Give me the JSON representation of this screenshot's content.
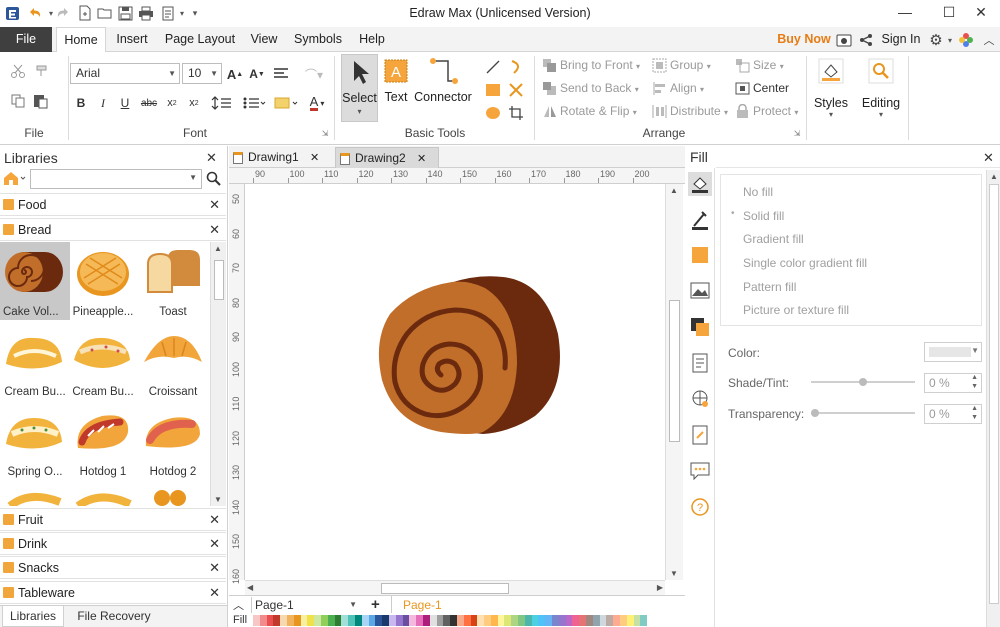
{
  "app": {
    "title": "Edraw Max (Unlicensed Version)"
  },
  "menu": {
    "file": "File",
    "tabs": [
      "Home",
      "Insert",
      "Page Layout",
      "View",
      "Symbols",
      "Help"
    ],
    "buy_now": "Buy Now",
    "sign_in": "Sign In"
  },
  "ribbon": {
    "font_name": "Arial",
    "font_size": "10",
    "groups": {
      "file": "File",
      "font": "Font",
      "basic_tools": "Basic Tools",
      "arrange": "Arrange"
    },
    "select": "Select",
    "text": "Text",
    "connector": "Connector",
    "arrange": {
      "bring_to_front": "Bring to Front",
      "send_to_back": "Send to Back",
      "rotate_flip": "Rotate & Flip",
      "group": "Group",
      "align": "Align",
      "distribute": "Distribute",
      "size": "Size",
      "center": "Center",
      "protect": "Protect"
    },
    "styles": "Styles",
    "editing": "Editing"
  },
  "libraries": {
    "title": "Libraries",
    "search_value": "",
    "categories_top": [
      "Food",
      "Bread"
    ],
    "bread_items": [
      "Cake Vol...",
      "Pineapple...",
      "Toast",
      "Cream Bu...",
      "Cream Bu...",
      "Croissant",
      "Spring O...",
      "Hotdog 1",
      "Hotdog 2"
    ],
    "categories_bottom": [
      "Fruit",
      "Drink",
      "Snacks",
      "Tableware"
    ],
    "bottom_tabs": [
      "Libraries",
      "File Recovery"
    ]
  },
  "documents": {
    "tabs": [
      "Drawing1",
      "Drawing2"
    ],
    "active": "Drawing2"
  },
  "ruler": {
    "h_ticks": [
      "90",
      "100",
      "110",
      "120",
      "130",
      "140",
      "150",
      "160",
      "170",
      "180",
      "190",
      "200"
    ],
    "v_ticks": [
      "50",
      "60",
      "70",
      "80",
      "90",
      "100",
      "110",
      "120",
      "130",
      "140",
      "150",
      "160"
    ]
  },
  "pages": {
    "selector": "Page-1",
    "active_tab": "Page-1",
    "fill_label": "Fill"
  },
  "fill_panel": {
    "title": "Fill",
    "options": [
      "No fill",
      "Solid fill",
      "Gradient fill",
      "Single color gradient fill",
      "Pattern fill",
      "Picture or texture fill"
    ],
    "color_label": "Color:",
    "shade_label": "Shade/Tint:",
    "shade_value": "0 %",
    "transparency_label": "Transparency:",
    "transparency_value": "0 %"
  },
  "colors": {
    "accent": "#2b579a",
    "orange": "#f0a63a",
    "buy": "#e87c14",
    "cake_light": "#c16e2a",
    "cake_dark": "#6b2a0e"
  }
}
